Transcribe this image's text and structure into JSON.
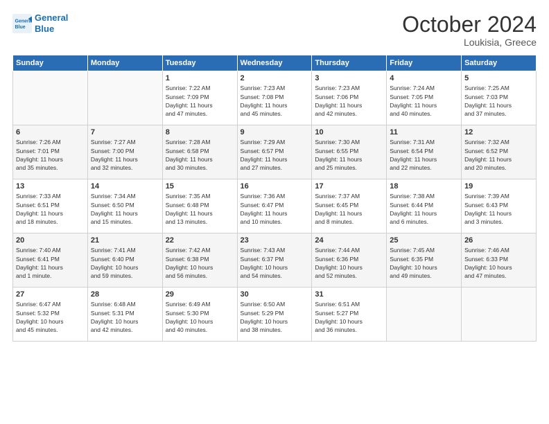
{
  "logo": {
    "line1": "General",
    "line2": "Blue"
  },
  "title": "October 2024",
  "location": "Loukisia, Greece",
  "headers": [
    "Sunday",
    "Monday",
    "Tuesday",
    "Wednesday",
    "Thursday",
    "Friday",
    "Saturday"
  ],
  "rows": [
    [
      {
        "day": "",
        "text": ""
      },
      {
        "day": "",
        "text": ""
      },
      {
        "day": "1",
        "text": "Sunrise: 7:22 AM\nSunset: 7:09 PM\nDaylight: 11 hours\nand 47 minutes."
      },
      {
        "day": "2",
        "text": "Sunrise: 7:23 AM\nSunset: 7:08 PM\nDaylight: 11 hours\nand 45 minutes."
      },
      {
        "day": "3",
        "text": "Sunrise: 7:23 AM\nSunset: 7:06 PM\nDaylight: 11 hours\nand 42 minutes."
      },
      {
        "day": "4",
        "text": "Sunrise: 7:24 AM\nSunset: 7:05 PM\nDaylight: 11 hours\nand 40 minutes."
      },
      {
        "day": "5",
        "text": "Sunrise: 7:25 AM\nSunset: 7:03 PM\nDaylight: 11 hours\nand 37 minutes."
      }
    ],
    [
      {
        "day": "6",
        "text": "Sunrise: 7:26 AM\nSunset: 7:01 PM\nDaylight: 11 hours\nand 35 minutes."
      },
      {
        "day": "7",
        "text": "Sunrise: 7:27 AM\nSunset: 7:00 PM\nDaylight: 11 hours\nand 32 minutes."
      },
      {
        "day": "8",
        "text": "Sunrise: 7:28 AM\nSunset: 6:58 PM\nDaylight: 11 hours\nand 30 minutes."
      },
      {
        "day": "9",
        "text": "Sunrise: 7:29 AM\nSunset: 6:57 PM\nDaylight: 11 hours\nand 27 minutes."
      },
      {
        "day": "10",
        "text": "Sunrise: 7:30 AM\nSunset: 6:55 PM\nDaylight: 11 hours\nand 25 minutes."
      },
      {
        "day": "11",
        "text": "Sunrise: 7:31 AM\nSunset: 6:54 PM\nDaylight: 11 hours\nand 22 minutes."
      },
      {
        "day": "12",
        "text": "Sunrise: 7:32 AM\nSunset: 6:52 PM\nDaylight: 11 hours\nand 20 minutes."
      }
    ],
    [
      {
        "day": "13",
        "text": "Sunrise: 7:33 AM\nSunset: 6:51 PM\nDaylight: 11 hours\nand 18 minutes."
      },
      {
        "day": "14",
        "text": "Sunrise: 7:34 AM\nSunset: 6:50 PM\nDaylight: 11 hours\nand 15 minutes."
      },
      {
        "day": "15",
        "text": "Sunrise: 7:35 AM\nSunset: 6:48 PM\nDaylight: 11 hours\nand 13 minutes."
      },
      {
        "day": "16",
        "text": "Sunrise: 7:36 AM\nSunset: 6:47 PM\nDaylight: 11 hours\nand 10 minutes."
      },
      {
        "day": "17",
        "text": "Sunrise: 7:37 AM\nSunset: 6:45 PM\nDaylight: 11 hours\nand 8 minutes."
      },
      {
        "day": "18",
        "text": "Sunrise: 7:38 AM\nSunset: 6:44 PM\nDaylight: 11 hours\nand 6 minutes."
      },
      {
        "day": "19",
        "text": "Sunrise: 7:39 AM\nSunset: 6:43 PM\nDaylight: 11 hours\nand 3 minutes."
      }
    ],
    [
      {
        "day": "20",
        "text": "Sunrise: 7:40 AM\nSunset: 6:41 PM\nDaylight: 11 hours\nand 1 minute."
      },
      {
        "day": "21",
        "text": "Sunrise: 7:41 AM\nSunset: 6:40 PM\nDaylight: 10 hours\nand 59 minutes."
      },
      {
        "day": "22",
        "text": "Sunrise: 7:42 AM\nSunset: 6:38 PM\nDaylight: 10 hours\nand 56 minutes."
      },
      {
        "day": "23",
        "text": "Sunrise: 7:43 AM\nSunset: 6:37 PM\nDaylight: 10 hours\nand 54 minutes."
      },
      {
        "day": "24",
        "text": "Sunrise: 7:44 AM\nSunset: 6:36 PM\nDaylight: 10 hours\nand 52 minutes."
      },
      {
        "day": "25",
        "text": "Sunrise: 7:45 AM\nSunset: 6:35 PM\nDaylight: 10 hours\nand 49 minutes."
      },
      {
        "day": "26",
        "text": "Sunrise: 7:46 AM\nSunset: 6:33 PM\nDaylight: 10 hours\nand 47 minutes."
      }
    ],
    [
      {
        "day": "27",
        "text": "Sunrise: 6:47 AM\nSunset: 5:32 PM\nDaylight: 10 hours\nand 45 minutes."
      },
      {
        "day": "28",
        "text": "Sunrise: 6:48 AM\nSunset: 5:31 PM\nDaylight: 10 hours\nand 42 minutes."
      },
      {
        "day": "29",
        "text": "Sunrise: 6:49 AM\nSunset: 5:30 PM\nDaylight: 10 hours\nand 40 minutes."
      },
      {
        "day": "30",
        "text": "Sunrise: 6:50 AM\nSunset: 5:29 PM\nDaylight: 10 hours\nand 38 minutes."
      },
      {
        "day": "31",
        "text": "Sunrise: 6:51 AM\nSunset: 5:27 PM\nDaylight: 10 hours\nand 36 minutes."
      },
      {
        "day": "",
        "text": ""
      },
      {
        "day": "",
        "text": ""
      }
    ]
  ]
}
